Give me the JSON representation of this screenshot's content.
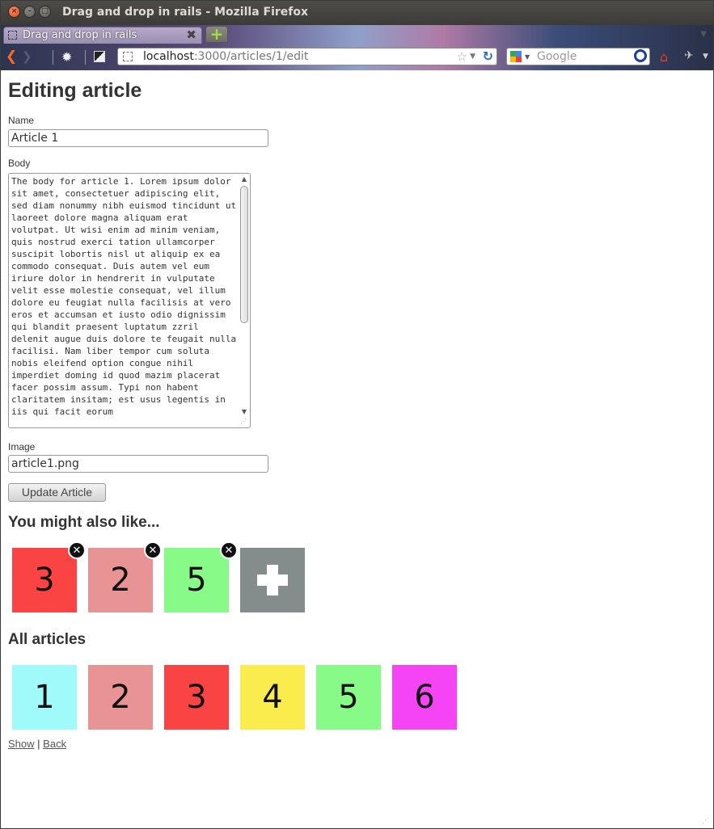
{
  "window": {
    "title": "Drag and drop in rails - Mozilla Firefox"
  },
  "tab": {
    "label": "Drag and drop in rails"
  },
  "navbar": {
    "url_host": "localhost",
    "url_rest": ":3000/articles/1/edit",
    "search_placeholder": "Google"
  },
  "page": {
    "heading": "Editing article",
    "name_label": "Name",
    "name_value": "Article 1",
    "body_label": "Body",
    "body_value": "The body for article 1. Lorem ipsum dolor sit amet, consectetuer adipiscing elit, sed diam nonummy nibh euismod tincidunt ut laoreet dolore magna aliquam erat volutpat. Ut wisi enim ad minim veniam, quis nostrud exerci tation ullamcorper suscipit lobortis nisl ut aliquip ex ea commodo consequat. Duis autem vel eum iriure dolor in hendrerit in vulputate velit esse molestie consequat, vel illum dolore eu feugiat nulla facilisis at vero eros et accumsan et iusto odio dignissim qui blandit praesent luptatum zzril delenit augue duis dolore te feugait nulla facilisi. Nam liber tempor cum soluta nobis eleifend option congue nihil imperdiet doming id quod mazim placerat facer possim assum. Typi non habent claritatem insitam; est usus legentis in iis qui facit eorum",
    "image_label": "Image",
    "image_value": "article1.png",
    "submit_label": "Update Article",
    "related_heading": "You might also like...",
    "related": [
      {
        "label": "3",
        "color": "#fa4444"
      },
      {
        "label": "2",
        "color": "#e89494"
      },
      {
        "label": "5",
        "color": "#88fa88"
      }
    ],
    "add_color": "#858c8c",
    "all_heading": "All articles",
    "articles": [
      {
        "label": "1",
        "color": "#a0fafa"
      },
      {
        "label": "2",
        "color": "#e89494"
      },
      {
        "label": "3",
        "color": "#fa4444"
      },
      {
        "label": "4",
        "color": "#faec4c"
      },
      {
        "label": "5",
        "color": "#88fa88"
      },
      {
        "label": "6",
        "color": "#f444f4"
      }
    ],
    "show_link": "Show",
    "separator": "|",
    "back_link": "Back"
  }
}
